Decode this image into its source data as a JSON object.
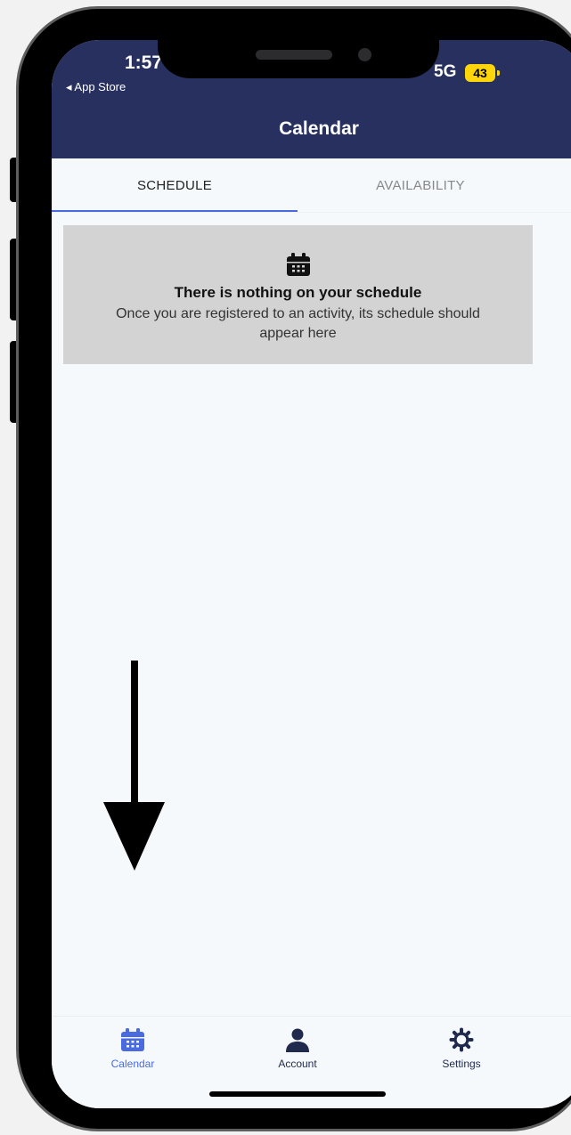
{
  "status_bar": {
    "time": "1:57",
    "back_label": "◂ App Store",
    "network": "5G",
    "battery": "43"
  },
  "nav": {
    "title": "Calendar"
  },
  "tabs": [
    {
      "label": "SCHEDULE",
      "active": true
    },
    {
      "label": "AVAILABILITY",
      "active": false
    }
  ],
  "empty_state": {
    "icon": "calendar-icon",
    "title": "There is nothing on your schedule",
    "description": "Once you are registered to an activity, its schedule should appear here"
  },
  "bottom_tabs": [
    {
      "label": "Calendar",
      "icon": "calendar-icon",
      "active": true
    },
    {
      "label": "Account",
      "icon": "person-icon",
      "active": false
    },
    {
      "label": "Settings",
      "icon": "gear-icon",
      "active": false
    }
  ],
  "colors": {
    "nav_background": "#27305e",
    "tab_indicator": "#4a6bdf",
    "active_tab_icon": "#4a6bdf",
    "inactive_tab_icon": "#1f2a4d",
    "empty_card_background": "#d3d3d3",
    "battery": "#ffd60a"
  }
}
